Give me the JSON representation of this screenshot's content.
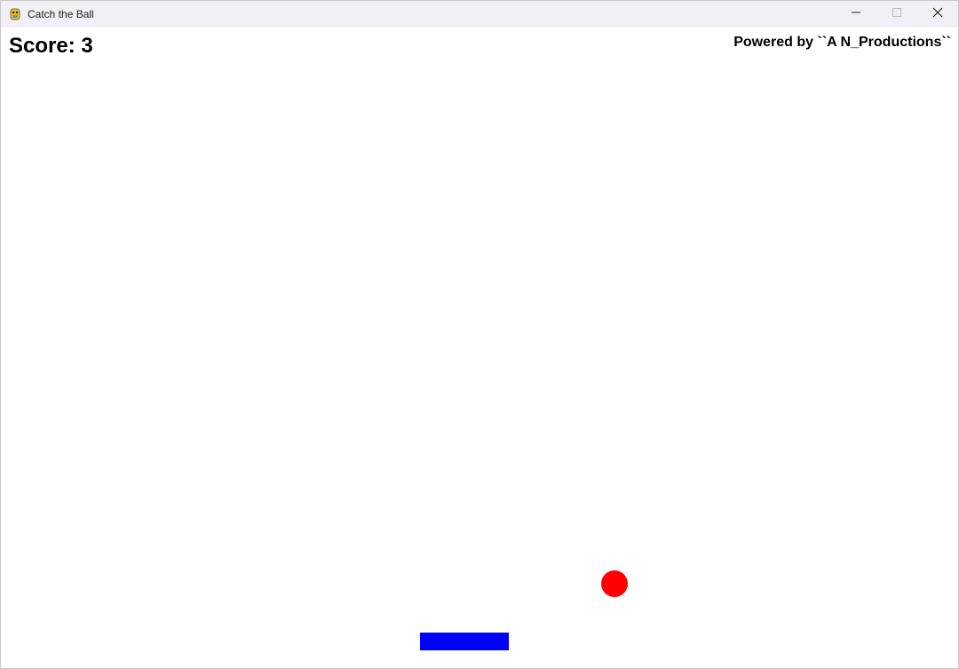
{
  "window": {
    "title": "Catch the Ball",
    "icon": "pygame-snake-icon",
    "controls": [
      "minimize-icon",
      "maximize-icon",
      "close-icon"
    ]
  },
  "hud": {
    "score_text": "Score: 3",
    "credit_text": "Powered by ``A N_Productions``"
  },
  "game": {
    "score": 3,
    "ball_color": "#ff0000",
    "paddle_color": "#0000ff",
    "background_color": "#ffffff"
  }
}
